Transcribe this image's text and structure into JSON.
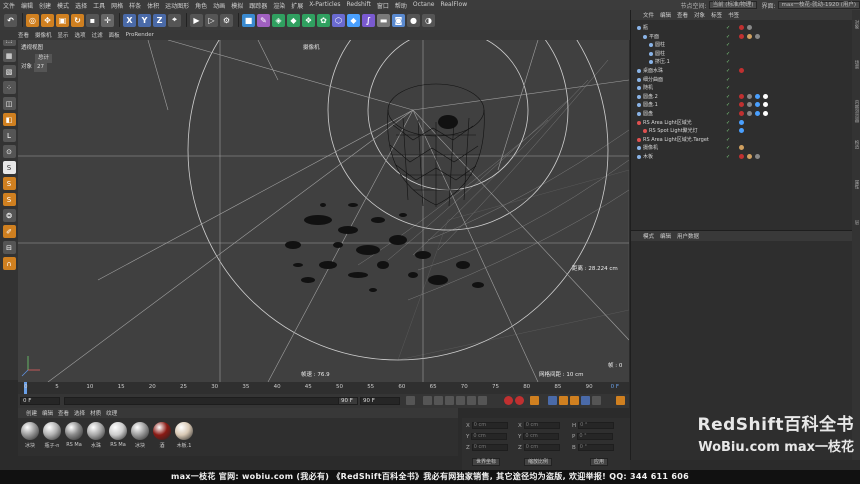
{
  "menubar": {
    "items": [
      "文件",
      "编辑",
      "创建",
      "模式",
      "选择",
      "工具",
      "网格",
      "样条",
      "体积",
      "运动图形",
      "角色",
      "动画",
      "模拟",
      "跟踪器",
      "渲染",
      "扩展",
      "X-Particles",
      "Redshift",
      "窗口",
      "帮助",
      "Octane",
      "RealFlow"
    ],
    "node_space_label": "节点空间:",
    "node_space_value": "当前 (标准/物理)",
    "layout_label": "界面:",
    "layout_value": "max一枝花-就动-1920 (用户)"
  },
  "toolbar": {
    "axis_x": "X",
    "axis_y": "Y",
    "axis_z": "Z"
  },
  "viewport_menu": [
    "查看",
    "摄像机",
    "显示",
    "选项",
    "过滤",
    "面板",
    "ProRender"
  ],
  "viewport": {
    "label": "透视视图",
    "camera": "摄像机",
    "stat_total": "总计",
    "stat_object_label": "对象",
    "stat_object_value": "27",
    "distance": "距离 : 28.224 cm",
    "fps": "帧速 : 76.9",
    "frame": "帧 : 0",
    "grid": "网格间距 : 10 cm"
  },
  "timeline": {
    "ticks": [
      "0",
      "5",
      "10",
      "15",
      "20",
      "25",
      "30",
      "35",
      "40",
      "45",
      "50",
      "55",
      "60",
      "65",
      "70",
      "75",
      "80",
      "85",
      "90"
    ],
    "current_frame": "0 F",
    "start_frame": "0 F",
    "end_frame": "90 F",
    "end_frame2": "90 F"
  },
  "material_menu": [
    "创建",
    "编辑",
    "查看",
    "选择",
    "材质",
    "纹理"
  ],
  "materials": [
    {
      "name": "冰块",
      "color": "#9a9a9a"
    },
    {
      "name": "瓶子-n",
      "color": "#b0b0b0"
    },
    {
      "name": "RS Ma",
      "color": "#888888"
    },
    {
      "name": "水珠",
      "color": "#a8a8a8"
    },
    {
      "name": "RS Ma",
      "color": "#cccccc"
    },
    {
      "name": "冰块",
      "color": "#9c9c9c"
    },
    {
      "name": "酒",
      "color": "#8a1a14"
    },
    {
      "name": "木板.1",
      "color": "#d8c8b4"
    }
  ],
  "coords": {
    "x_label": "X",
    "y_label": "Y",
    "z_label": "Z",
    "h_label": "H",
    "p_label": "P",
    "b_label": "B",
    "x2_label": "X",
    "y2_label": "Y",
    "z2_label": "Z",
    "pos_value": "0 cm",
    "rot_value": "0 °",
    "world_button": "世界坐标",
    "scale_button": "缩放比例",
    "apply_button": "应用"
  },
  "object_menu": [
    "文件",
    "编辑",
    "查看",
    "对象",
    "标签",
    "书签"
  ],
  "objects": [
    {
      "name": "瓶",
      "indent": 0,
      "color": "#8ab4e8",
      "tags": [
        "#c03030",
        "#888"
      ]
    },
    {
      "name": "平面",
      "indent": 1,
      "color": "#8ab4e8",
      "tags": [
        "#c03030",
        "#d0a060",
        "#888"
      ]
    },
    {
      "name": "圆柱",
      "indent": 2,
      "color": "#8ab4e8",
      "tags": []
    },
    {
      "name": "圆柱",
      "indent": 2,
      "color": "#8ab4e8",
      "tags": []
    },
    {
      "name": "挤压.1",
      "indent": 2,
      "color": "#8ab4e8",
      "tags": []
    },
    {
      "name": "桌面水珠",
      "indent": 0,
      "color": "#8ab4e8",
      "tags": [
        "#c03030"
      ]
    },
    {
      "name": "细分曲面",
      "indent": 0,
      "color": "#8ab4e8",
      "tags": []
    },
    {
      "name": "随机",
      "indent": 0,
      "color": "#8ab4e8",
      "tags": []
    },
    {
      "name": "圆盘.2",
      "indent": 0,
      "color": "#8ab4e8",
      "tags": [
        "#c03030",
        "#888",
        "#4aa0ff",
        "#fff"
      ]
    },
    {
      "name": "圆盘.1",
      "indent": 0,
      "color": "#8ab4e8",
      "tags": [
        "#c03030",
        "#888",
        "#4aa0ff",
        "#fff"
      ]
    },
    {
      "name": "圆盘",
      "indent": 0,
      "color": "#8ab4e8",
      "tags": [
        "#c03030",
        "#888",
        "#4aa0ff",
        "#fff"
      ]
    },
    {
      "name": "RS Area Light区域光",
      "indent": 0,
      "color": "#e05050",
      "tags": [
        "#4aa0ff"
      ]
    },
    {
      "name": "RS Spot Light聚光灯",
      "indent": 1,
      "color": "#e05050",
      "tags": [
        "#4aa0ff"
      ]
    },
    {
      "name": "RS Area Light区域光.Target",
      "indent": 0,
      "color": "#e05050",
      "tags": []
    },
    {
      "name": "摄像机",
      "indent": 0,
      "color": "#8ab4e8",
      "tags": [
        "#d0a060"
      ]
    },
    {
      "name": "木板",
      "indent": 0,
      "color": "#8ab4e8",
      "tags": [
        "#c03030",
        "#d0a060",
        "#888"
      ]
    }
  ],
  "attr_menu": [
    "模式",
    "编辑",
    "用户数据"
  ],
  "right_strip": [
    "对象",
    "场景",
    "内容浏览器",
    "构造",
    "属性",
    "层"
  ],
  "watermark": {
    "line1": "RedShift百科全书",
    "line2": "WoBiu.com  max一枝花"
  },
  "banner": "max一枝花 官网: wobiu.com (我必有)    《RedShift百科全书》我必有网独家销售, 其它途径均为盗版, 欢迎举报!    QQ: 344 611 606"
}
